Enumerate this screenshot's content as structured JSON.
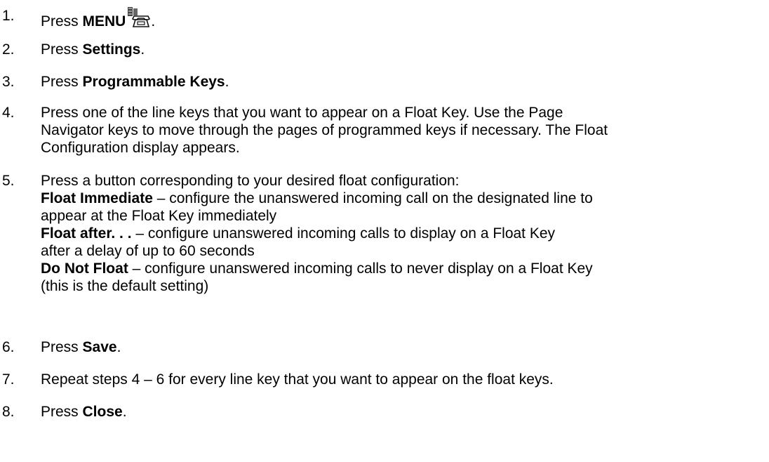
{
  "steps": [
    {
      "num": "1.",
      "press": "Press ",
      "bold": "MENU",
      "icon": "menu-key-icon",
      "after": "."
    },
    {
      "num": "2.",
      "press": "Press ",
      "bold": "Settings",
      "after": "."
    },
    {
      "num": "3.",
      "press": "Press ",
      "bold": "Programmable Keys",
      "after": "."
    },
    {
      "num": "4.",
      "lines": [
        "Press one of the line keys that you want to appear on a Float Key. Use the Page",
        "Navigator keys to move through the pages of programmed keys if necessary. The Float",
        "Configuration display appears."
      ]
    },
    {
      "num": "5.",
      "intro": "Press a button corresponding to your desired float configuration:",
      "options": [
        {
          "bold": "Float Immediate",
          "text1": " – configure the unanswered incoming call on the designated line to",
          "text2": "appear at the Float Key immediately"
        },
        {
          "bold": "Float after. . .",
          "text1": " – configure unanswered incoming calls to display on a Float Key",
          "text2": "after a delay of up to 60 seconds"
        },
        {
          "bold": "Do Not Float",
          "text1": " – configure unanswered incoming calls to never display on a Float Key",
          "text2": "(this is the default setting)"
        }
      ]
    },
    {
      "num": "6.",
      "press": "Press ",
      "bold": "Save",
      "after": "."
    },
    {
      "num": "7.",
      "text": "Repeat steps 4 – 6 for every line key that you want to appear on the float keys."
    },
    {
      "num": "8.",
      "press": "Press ",
      "bold": "Close",
      "after": "."
    }
  ]
}
